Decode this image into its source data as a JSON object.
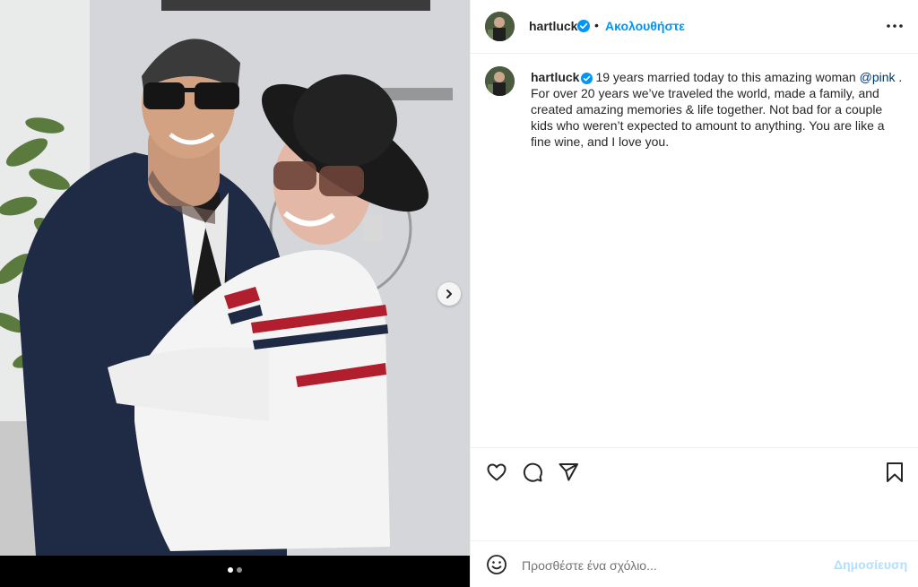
{
  "post": {
    "username": "hartluck",
    "verified": true,
    "separator": "•",
    "follow_label": "Ακολουθήστε",
    "more_icon": "more-horizontal-icon",
    "caption_part1": "19 years married today to this amazing woman",
    "mention": "@pink",
    "caption_part2": ". For over 20 years we’ve traveled the world, made a family, and created amazing memories & life together. Not bad for a couple kids who weren’t expected to amount to anything. You are like a fine wine, and I love you."
  },
  "media": {
    "current_slide": 1,
    "total_slides": 2,
    "next_icon": "chevron-right-icon"
  },
  "actions": {
    "like_icon": "heart-icon",
    "comment_icon": "comment-icon",
    "share_icon": "send-icon",
    "save_icon": "bookmark-icon"
  },
  "comment_box": {
    "emoji_icon": "emoji-icon",
    "placeholder": "Προσθέστε ένα σχόλιο...",
    "post_label": "Δημοσίευση"
  },
  "colors": {
    "accent": "#0095f6",
    "post_disabled": "#b2dffc",
    "mention": "#00376b",
    "verified": "#0095f6"
  }
}
